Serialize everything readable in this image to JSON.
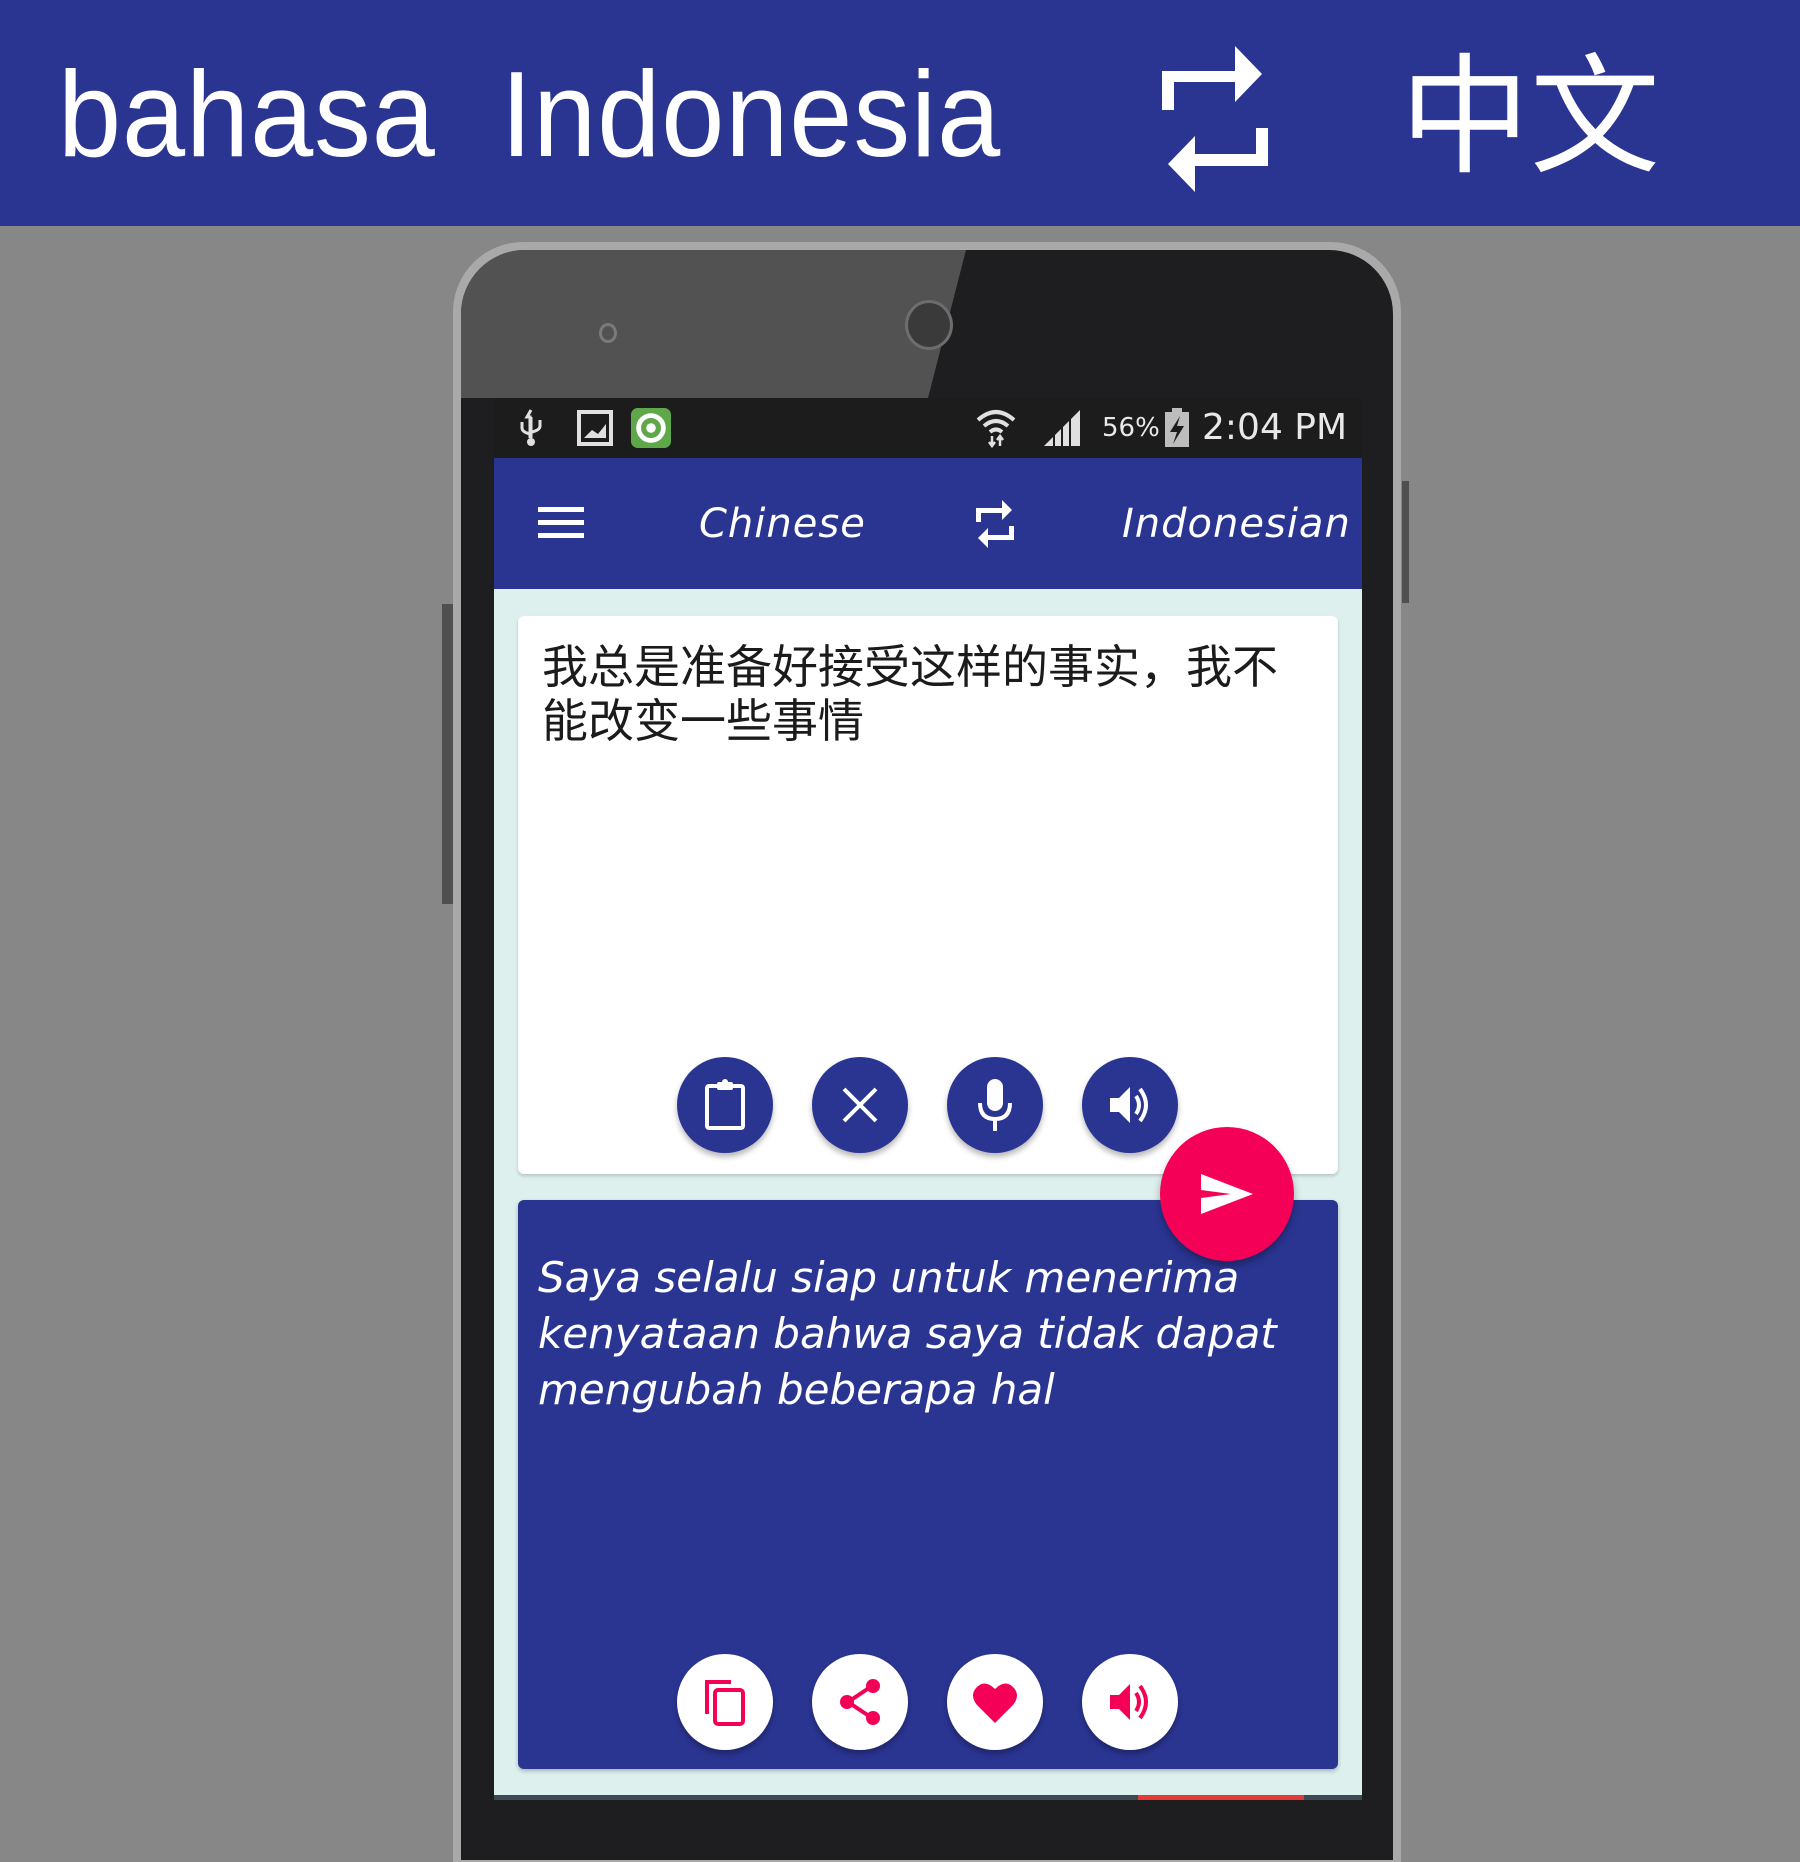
{
  "banner": {
    "source_language": "bahasa  Indonesia",
    "target_language": "中文",
    "swap_icon": "swap-arrows-icon",
    "background_color": "#2a3592"
  },
  "status_bar": {
    "left_icons": [
      "usb-icon",
      "image-icon",
      "app-notification-icon"
    ],
    "right_icons": [
      "wifi-icon",
      "signal-icon",
      "battery-charging-icon"
    ],
    "battery": "56%",
    "time": "2:04 PM"
  },
  "app_bar": {
    "menu_icon": "hamburger-menu-icon",
    "source_language": "Chinese",
    "swap_icon": "swap-arrows-icon",
    "target_language": "Indonesian",
    "color": "#2a3592"
  },
  "input_card": {
    "text": "我总是准备好接受这样的事实，我不能改变一些事情",
    "actions": [
      {
        "name": "paste",
        "icon": "clipboard-icon"
      },
      {
        "name": "clear",
        "icon": "close-icon"
      },
      {
        "name": "voice-input",
        "icon": "microphone-icon"
      },
      {
        "name": "speak",
        "icon": "speaker-icon"
      }
    ]
  },
  "translate_button": {
    "icon": "send-icon",
    "color": "#f50057"
  },
  "output_card": {
    "text": "Saya selalu siap untuk menerima kenyataan bahwa saya tidak dapat mengubah beberapa hal",
    "actions": [
      {
        "name": "copy",
        "icon": "copy-icon"
      },
      {
        "name": "share",
        "icon": "share-icon"
      },
      {
        "name": "favorite",
        "icon": "heart-icon"
      },
      {
        "name": "speak",
        "icon": "speaker-icon"
      }
    ],
    "accent_color": "#f50057"
  }
}
